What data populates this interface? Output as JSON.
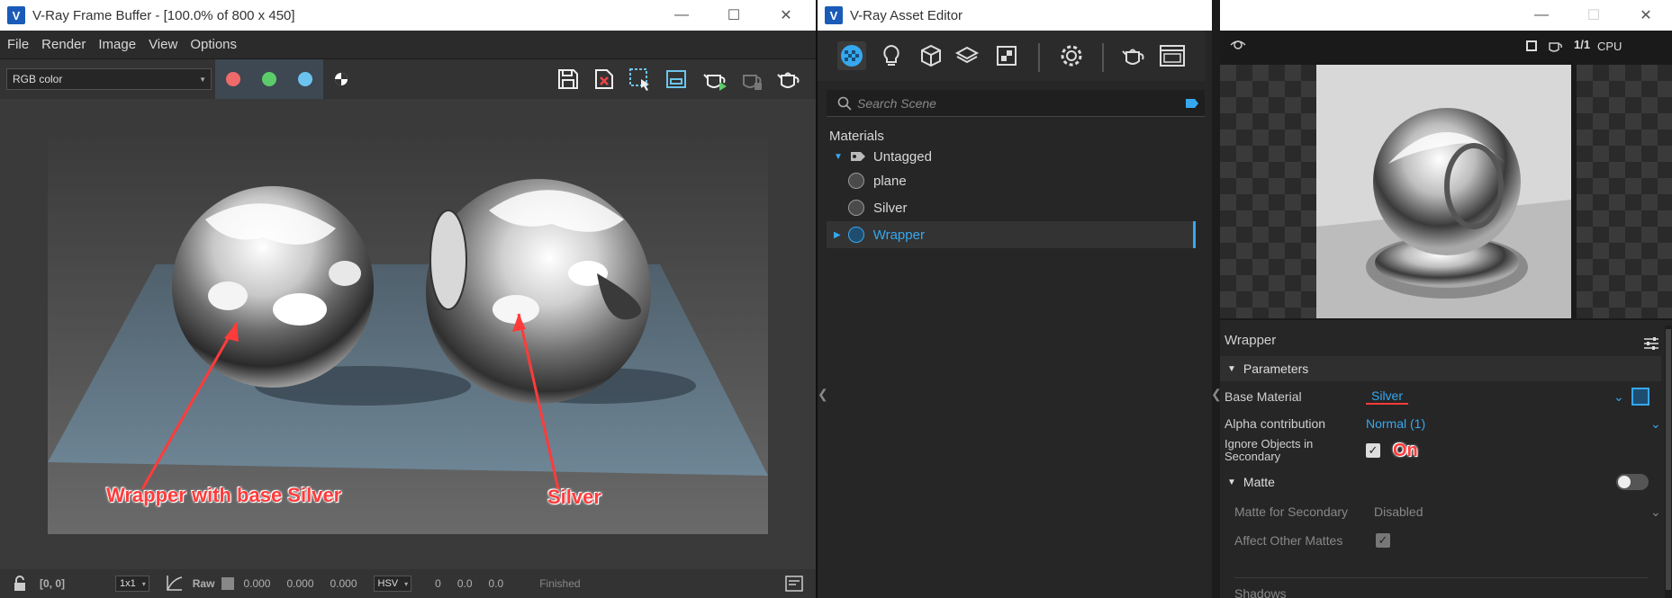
{
  "vfb": {
    "title": "V-Ray Frame Buffer - [100.0% of 800 x 450]",
    "menu": [
      "File",
      "Render",
      "Image",
      "View",
      "Options"
    ],
    "channel_select": "RGB color",
    "annotations": {
      "wrapper": "Wrapper with base Silver",
      "silver": "Silver"
    },
    "status": {
      "coords": "[0, 0]",
      "sample": "1x1",
      "raw_label": "Raw",
      "raw_values": [
        "0.000",
        "0.000",
        "0.000"
      ],
      "color_mode": "HSV",
      "hsv_values": [
        "0",
        "0.0",
        "0.0"
      ],
      "state": "Finished"
    },
    "colors": {
      "red": "#ef6a6a",
      "green": "#5ccc6a",
      "blue": "#6cc4ee"
    }
  },
  "ae": {
    "title": "V-Ray Asset Editor",
    "search_placeholder": "Search Scene",
    "materials_header": "Materials",
    "tag_untagged": "Untagged",
    "items": [
      "plane",
      "Silver",
      "Wrapper"
    ],
    "cpu_label": "CPU",
    "fraction": "1/1",
    "panel_title": "Wrapper",
    "parameters_header": "Parameters",
    "base_material_label": "Base Material",
    "base_material_value": "Silver",
    "alpha_label": "Alpha contribution",
    "alpha_value": "Normal (1)",
    "ignore_label": "Ignore Objects in Secondary",
    "ignore_annot": "On",
    "matte_header": "Matte",
    "matte_secondary_label": "Matte for Secondary",
    "matte_secondary_value": "Disabled",
    "affect_label": "Affect Other Mattes",
    "cut_label": "Shadows"
  }
}
